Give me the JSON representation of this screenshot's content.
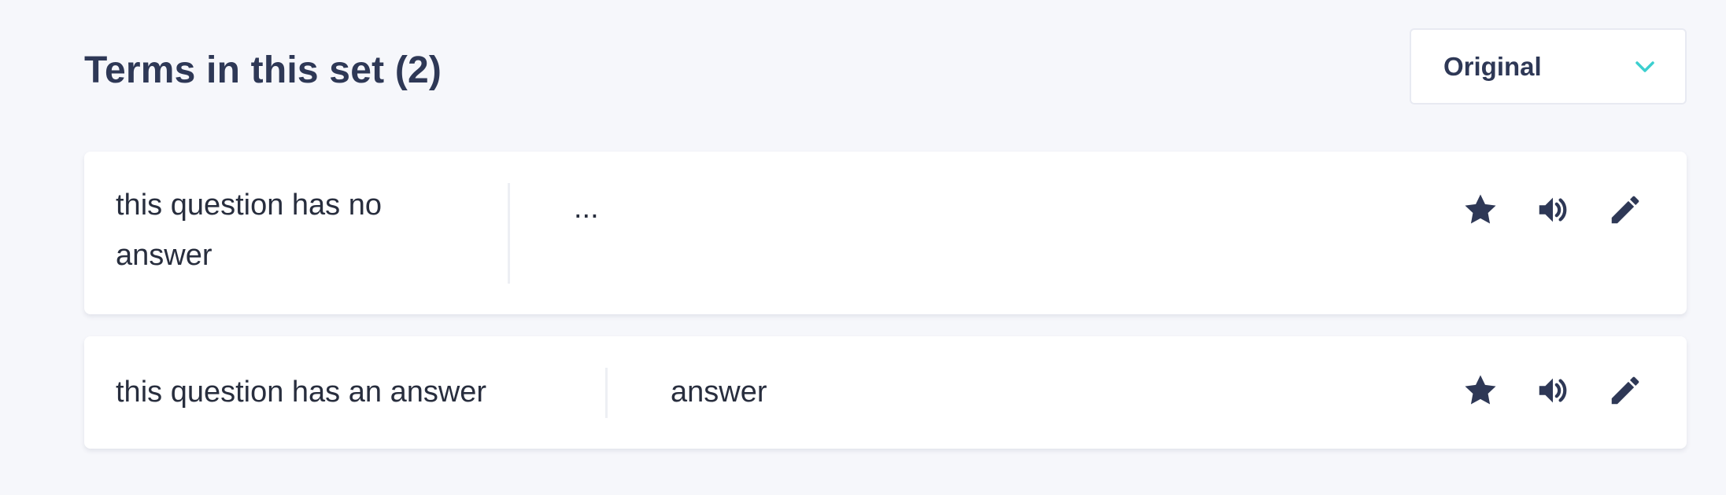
{
  "header": {
    "title": "Terms in this set (2)",
    "sort_select": {
      "selected": "Original"
    }
  },
  "colors": {
    "background": "#f6f7fb",
    "card": "#ffffff",
    "text": "#2e3856",
    "chevron_accent": "#3ccfcf"
  },
  "terms": [
    {
      "term": "this question has no answer",
      "definition": "..."
    },
    {
      "term": "this question has an answer",
      "definition": "answer"
    }
  ],
  "row_actions": {
    "icons": [
      "star-icon",
      "speaker-icon",
      "pencil-icon"
    ]
  }
}
